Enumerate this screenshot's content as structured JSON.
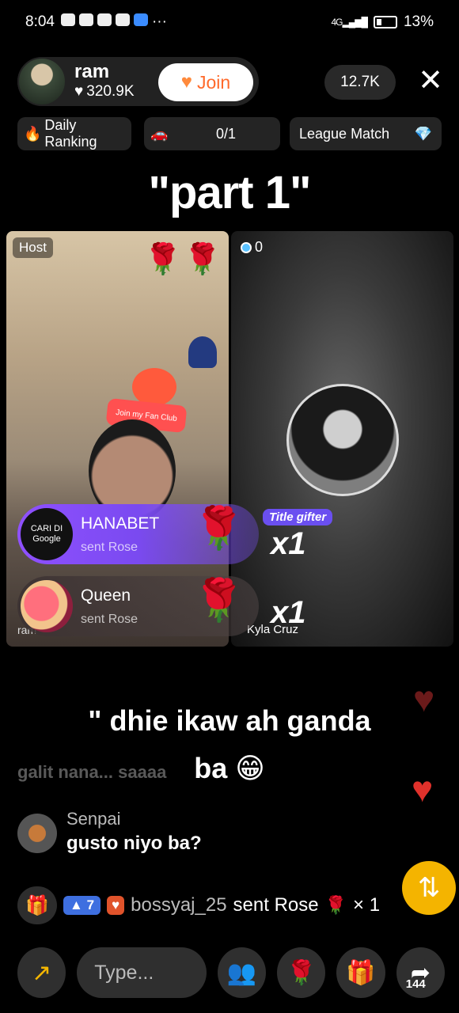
{
  "status_bar": {
    "time": "8:04",
    "battery": "13%",
    "network": "4G"
  },
  "host": {
    "name": "ram",
    "likes": "320.9K",
    "join_label": "Join"
  },
  "viewers": "12.7K",
  "chips": {
    "daily_ranking": "Daily Ranking",
    "match_score": "0/1",
    "league_match": "League Match"
  },
  "stream_title": "\"part 1\"",
  "host_panel": {
    "tag": "Host",
    "name_label": "ram",
    "fan_club_text": "Join my Fan Club"
  },
  "guest_panel": {
    "score": "0",
    "name": "Kyla Cruz",
    "title_gifter": "Title gifter"
  },
  "gift_feed": [
    {
      "avatar_text": "CARI DI Google",
      "user": "HANABET",
      "action": "sent Rose",
      "combo": "x1"
    },
    {
      "avatar_text": "",
      "user": "Queen",
      "action": "sent Rose",
      "combo": "x1"
    }
  ],
  "caption": {
    "line1": "\" dhie ikaw ah ganda",
    "line2": "ba 😁"
  },
  "comments": {
    "faded": "galit nana... saaaa",
    "latest": {
      "user": "Senpai",
      "text": "gusto niyo ba?"
    }
  },
  "gift_banner": {
    "level": "7",
    "user": "bossyaj_25",
    "action": "sent Rose",
    "combo": "× 1"
  },
  "bottom_bar": {
    "type_placeholder": "Type...",
    "share_count": "144"
  },
  "colors": {
    "join_text": "#ff6a2b",
    "gift_purple": "#8f50ff",
    "heart": "#e0312b",
    "share_yellow": "#f4b400"
  }
}
